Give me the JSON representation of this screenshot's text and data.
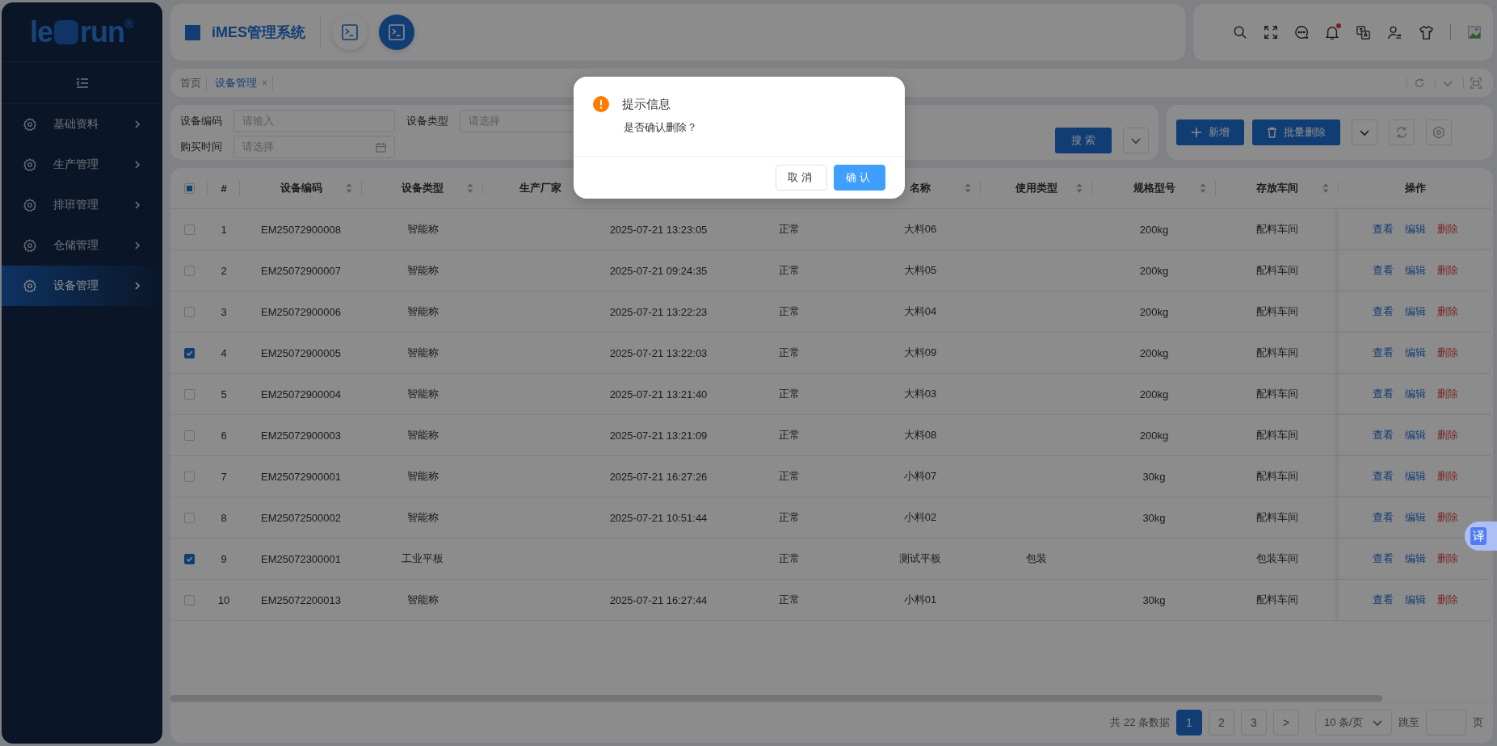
{
  "sidebar": {
    "logo": {
      "left": "le",
      "right": "run",
      "mark": "®"
    },
    "items": [
      {
        "label": "基础资料",
        "selected": false
      },
      {
        "label": "生产管理",
        "selected": false
      },
      {
        "label": "排班管理",
        "selected": false
      },
      {
        "label": "仓储管理",
        "selected": false
      },
      {
        "label": "设备管理",
        "selected": true
      }
    ]
  },
  "header": {
    "title": "iMES管理系统",
    "terminal_buttons": [
      {
        "selected": false
      },
      {
        "selected": true
      }
    ],
    "notification_dot": true
  },
  "tabs": [
    {
      "label": "首页",
      "selected": false
    },
    {
      "label": "设备管理",
      "selected": true,
      "close": "×"
    }
  ],
  "filters": [
    {
      "label": "设备编码",
      "placeholder": "请输入",
      "kind": "text"
    },
    {
      "label": "设备类型",
      "placeholder": "请选择",
      "kind": "select"
    },
    {
      "label": "购买时间",
      "placeholder": "请选择",
      "kind": "date"
    }
  ],
  "search_button": "搜索",
  "toolbar": {
    "add_button": "新增",
    "batch_delete_button": "批量删除"
  },
  "table": {
    "select_all": {
      "checked": false,
      "indeterminate": true
    },
    "columns": [
      {
        "label": "#",
        "sortable": false
      },
      {
        "label": "设备编码",
        "sortable": true
      },
      {
        "label": "设备类型",
        "sortable": true
      },
      {
        "label": "生产厂家"
      },
      {},
      {},
      {
        "label": "名称",
        "sortable": true
      },
      {
        "label": "使用类型",
        "sortable": true
      },
      {
        "label": "规格型号",
        "sortable": true
      },
      {
        "label": "存放车间",
        "sortable": true
      },
      {
        "label": "操作",
        "sortable": false
      }
    ],
    "rows": [
      {
        "checked": false,
        "index": "1",
        "code": "EM25072900008",
        "type": "智能称",
        "purchase_time": "2025-07-21 13:23:05",
        "status": "正常",
        "name": "大料06",
        "spec": "200kg",
        "workshop": "配料车间",
        "actions": [
          "查看",
          "编辑",
          "删除"
        ]
      },
      {
        "checked": false,
        "index": "2",
        "code": "EM25072900007",
        "type": "智能称",
        "purchase_time": "2025-07-21 09:24:35",
        "status": "正常",
        "name": "大料05",
        "spec": "200kg",
        "workshop": "配料车间",
        "actions": [
          "查看",
          "编辑",
          "删除"
        ]
      },
      {
        "checked": false,
        "index": "3",
        "code": "EM25072900006",
        "type": "智能称",
        "purchase_time": "2025-07-21 13:22:23",
        "status": "正常",
        "name": "大料04",
        "spec": "200kg",
        "workshop": "配料车间",
        "actions": [
          "查看",
          "编辑",
          "删除"
        ]
      },
      {
        "checked": true,
        "index": "4",
        "code": "EM25072900005",
        "type": "智能称",
        "purchase_time": "2025-07-21 13:22:03",
        "status": "正常",
        "name": "大料09",
        "spec": "200kg",
        "workshop": "配料车间",
        "actions": [
          "查看",
          "编辑",
          "删除"
        ]
      },
      {
        "checked": false,
        "index": "5",
        "code": "EM25072900004",
        "type": "智能称",
        "purchase_time": "2025-07-21 13:21:40",
        "status": "正常",
        "name": "大料03",
        "spec": "200kg",
        "workshop": "配料车间",
        "actions": [
          "查看",
          "编辑",
          "删除"
        ]
      },
      {
        "checked": false,
        "index": "6",
        "code": "EM25072900003",
        "type": "智能称",
        "purchase_time": "2025-07-21 13:21:09",
        "status": "正常",
        "name": "大料08",
        "spec": "200kg",
        "workshop": "配料车间",
        "actions": [
          "查看",
          "编辑",
          "删除"
        ]
      },
      {
        "checked": false,
        "index": "7",
        "code": "EM25072900001",
        "type": "智能称",
        "purchase_time": "2025-07-21 16:27:26",
        "status": "正常",
        "name": "小料07",
        "spec": "30kg",
        "workshop": "配料车间",
        "actions": [
          "查看",
          "编辑",
          "删除"
        ]
      },
      {
        "checked": false,
        "index": "8",
        "code": "EM25072500002",
        "type": "智能称",
        "purchase_time": "2025-07-21 10:51:44",
        "status": "正常",
        "name": "小料02",
        "spec": "30kg",
        "workshop": "配料车间",
        "actions": [
          "查看",
          "编辑",
          "删除"
        ]
      },
      {
        "checked": true,
        "index": "9",
        "code": "EM25072300001",
        "type": "工业平板",
        "status": "正常",
        "name": "测试平板",
        "usage_type": "包装",
        "workshop": "包装车间",
        "actions": [
          "查看",
          "编辑",
          "删除"
        ]
      },
      {
        "checked": false,
        "index": "10",
        "code": "EM25072200013",
        "type": "智能称",
        "purchase_time": "2025-07-21 16:27:44",
        "status": "正常",
        "name": "小料01",
        "spec": "30kg",
        "workshop": "配料车间",
        "actions": [
          "查看",
          "编辑",
          "删除"
        ]
      }
    ]
  },
  "pagination": {
    "total": "共 22 条数据",
    "pages": [
      {
        "label": "1",
        "selected": true
      },
      {
        "label": "2",
        "selected": false
      },
      {
        "label": "3",
        "selected": false
      }
    ],
    "next": ">",
    "page_size": "10 条/页",
    "jump_label": "跳至",
    "page_suffix": "页"
  },
  "dialog": {
    "title": "提示信息",
    "message": "是否确认删除？",
    "cancel": "取消",
    "confirm": "确认"
  },
  "translate_button": "译"
}
